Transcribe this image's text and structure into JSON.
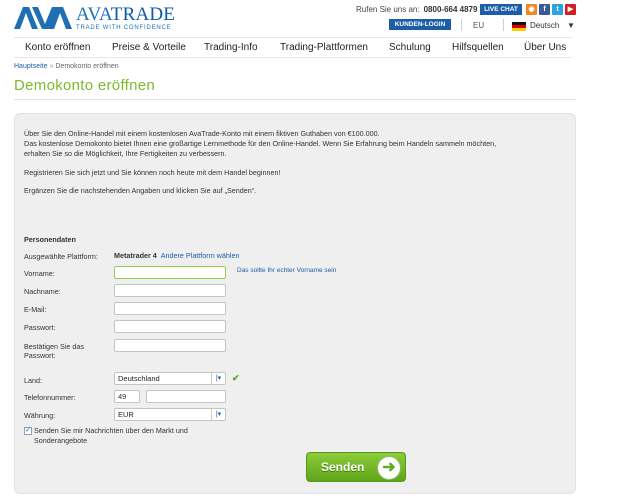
{
  "header": {
    "logo": {
      "name_part1": "AVA",
      "name_part2": "TRADE",
      "tagline": "TRADE WITH CONFIDENCE"
    },
    "call_us_label": "Rufen Sie uns an:",
    "phone": "0800-664 4879",
    "live_chat": "LIVE CHAT",
    "social_icons": [
      "rss-icon",
      "facebook-icon",
      "twitter-icon",
      "youtube-icon"
    ],
    "login_button": "KUNDEN-LOGIN",
    "region": "EU",
    "language": "Deutsch"
  },
  "nav": {
    "items": [
      "Konto eröffnen",
      "Preise & Vorteile",
      "Trading-Info",
      "Trading-Plattformen",
      "Schulung",
      "Hilfsquellen",
      "Über Uns"
    ]
  },
  "breadcrumb": {
    "home": "Hauptseite",
    "separator": "»",
    "current": "Demokonto eröffnen"
  },
  "page_title": "Demokonto eröffnen",
  "intro": {
    "line1": "Über Sie den Online-Handel mit einem kostenlosen AvaTrade-Konto mit einem fiktiven Guthaben von €100.000.",
    "line2": "Das kostenlose Demokonto bietet Ihnen eine großartige Lernmethode für den Online-Handel. Wenn Sie Erfahrung beim Handeln sammeln möchten,",
    "line3": "erhalten Sie so die Möglichkeit, Ihre Fertigkeiten zu verbessern.",
    "register_text": "Registrieren Sie sich jetzt und Sie können noch heute mit dem Handel beginnen!",
    "instruction": "Ergänzen Sie die nachstehenden Angaben und klicken Sie auf „Senden“."
  },
  "form": {
    "section_title": "Personendaten",
    "platform_label": "Ausgewählte Plattform:",
    "platform_value": "Metatrader 4",
    "platform_change_link": "Andere Plattform wählen",
    "firstname_label": "Vorname:",
    "firstname_hint": "Das sollte Ihr echter Vorname sein",
    "firstname_value": "",
    "lastname_label": "Nachname:",
    "lastname_value": "",
    "email_label": "E-Mail:",
    "email_value": "",
    "password_label": "Passwort:",
    "password_value": "",
    "confirm_password_label": "Bestätigen Sie das Passwort:",
    "confirm_password_value": "",
    "country_label": "Land:",
    "country_value": "Deutschland",
    "phone_label": "Telefonnummer:",
    "phone_prefix": "49",
    "phone_value": "",
    "currency_label": "Währung:",
    "currency_value": "EUR",
    "newsletter_checked": true,
    "newsletter_label": "Senden Sie mir Nachrichten über den Markt und Sonderangebote",
    "submit_label": "Senden"
  },
  "colors": {
    "brand_blue": "#1c5ea6",
    "title_green": "#7db92e",
    "button_green": "#6cb227",
    "panel_bg": "#efefef"
  }
}
